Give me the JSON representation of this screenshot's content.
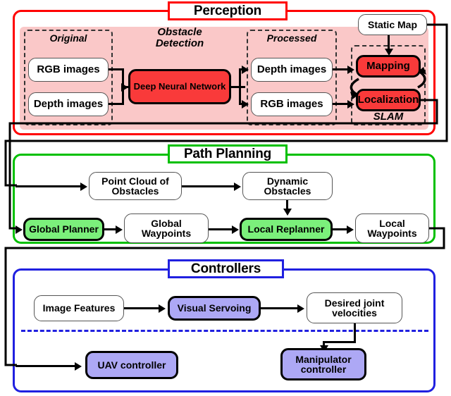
{
  "diagram": {
    "title": "Robotic system architecture: Perception, Path Planning, Controllers",
    "colors": {
      "perception_border": "#FF0000",
      "perception_panel": "#FAC8C8",
      "perception_node": "#F93A3A",
      "path_border": "#00C000",
      "path_node": "#7BF07B",
      "controller_border": "#2020E0",
      "controller_node": "#ADA8F5",
      "generic_node": "#FFFFFF",
      "line": "#000000"
    }
  },
  "sections": [
    {
      "id": "perception",
      "title": "Perception"
    },
    {
      "id": "path_planning",
      "title": "Path Planning"
    },
    {
      "id": "controllers",
      "title": "Controllers"
    }
  ],
  "perception": {
    "title": "Perception",
    "group_labels": {
      "original": "Original",
      "obstacle_detection": "Obstacle\nDetection",
      "obstacle_detection_line1": "Obstacle",
      "obstacle_detection_line2": "Detection",
      "processed": "Processed",
      "slam": "SLAM"
    },
    "nodes": [
      {
        "id": "rgb_in",
        "label": "RGB images",
        "style": "white"
      },
      {
        "id": "depth_in",
        "label": "Depth images",
        "style": "white"
      },
      {
        "id": "dnn",
        "label": "Deep Neural Network",
        "style": "red"
      },
      {
        "id": "depth_out",
        "label": "Depth images",
        "style": "white"
      },
      {
        "id": "rgb_out",
        "label": "RGB images",
        "style": "white"
      },
      {
        "id": "static_map",
        "label": "Static Map",
        "style": "white"
      },
      {
        "id": "mapping",
        "label": "Mapping",
        "style": "red"
      },
      {
        "id": "localization",
        "label": "Localization",
        "style": "red"
      }
    ]
  },
  "path_planning": {
    "title": "Path Planning",
    "nodes": [
      {
        "id": "point_cloud",
        "label": "Point Cloud of\nObstacles",
        "line1": "Point Cloud of",
        "line2": "Obstacles",
        "style": "white"
      },
      {
        "id": "dynamic_obstacles",
        "label": "Dynamic\nObstacles",
        "line1": "Dynamic",
        "line2": "Obstacles",
        "style": "white"
      },
      {
        "id": "global_planner",
        "label": "Global Planner",
        "line1": "Global Planner",
        "line2": "",
        "style": "green"
      },
      {
        "id": "global_waypoints",
        "label": "Global\nWaypoints",
        "line1": "Global",
        "line2": "Waypoints",
        "style": "white"
      },
      {
        "id": "local_replanner",
        "label": "Local Replanner",
        "line1": "Local Replanner",
        "line2": "",
        "style": "green"
      },
      {
        "id": "local_waypoints",
        "label": "Local\nWaypoints",
        "line1": "Local",
        "line2": "Waypoints",
        "style": "white"
      }
    ]
  },
  "controllers": {
    "title": "Controllers",
    "nodes": [
      {
        "id": "image_features",
        "label": "Image Features",
        "line1": "Image Features",
        "line2": "",
        "style": "white"
      },
      {
        "id": "visual_servoing",
        "label": "Visual Servoing",
        "line1": "Visual Servoing",
        "line2": "",
        "style": "purple"
      },
      {
        "id": "desired_joint_vel",
        "label": "Desired joint\nvelocities",
        "line1": "Desired joint",
        "line2": "velocities",
        "style": "white"
      },
      {
        "id": "uav_controller",
        "label": "UAV controller",
        "line1": "UAV controller",
        "line2": "",
        "style": "purple"
      },
      {
        "id": "manipulator_controller",
        "label": "Manipulator\ncontroller",
        "line1": "Manipulator",
        "line2": "controller",
        "style": "purple"
      }
    ]
  }
}
